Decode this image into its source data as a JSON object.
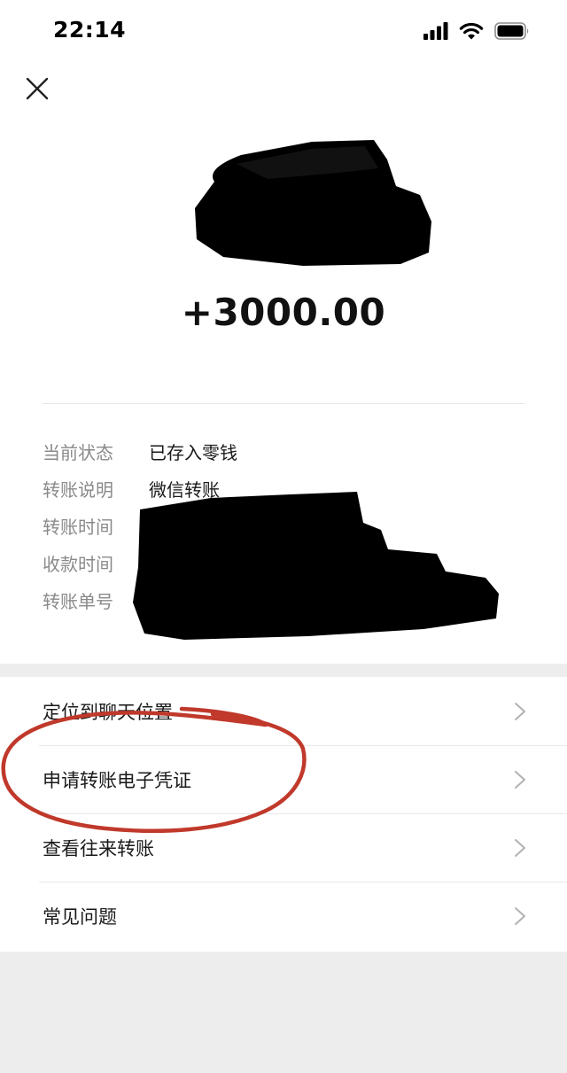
{
  "status_bar": {
    "time": "22:14"
  },
  "header": {
    "close_icon": "close-icon"
  },
  "amount": "+3000.00",
  "details": [
    {
      "label": "当前状态",
      "value": "已存入零钱"
    },
    {
      "label": "转账说明",
      "value": "微信转账"
    },
    {
      "label": "转账时间",
      "value": ""
    },
    {
      "label": "收款时间",
      "value": ""
    },
    {
      "label": "转账单号",
      "value": ""
    }
  ],
  "menu": [
    {
      "label": "定位到聊天位置"
    },
    {
      "label": "申请转账电子凭证"
    },
    {
      "label": "查看往来转账"
    },
    {
      "label": "常见问题"
    }
  ],
  "colors": {
    "background": "#ededed",
    "card": "#ffffff",
    "label_gray": "#8a8a8a",
    "annotation_red": "#c0392b"
  }
}
